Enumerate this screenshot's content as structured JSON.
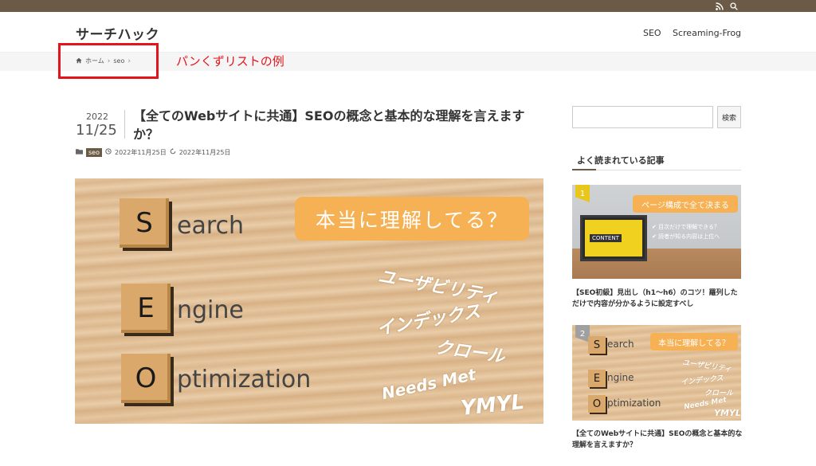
{
  "site": {
    "title": "サーチハック"
  },
  "topbar": {
    "rss_icon": "rss-icon",
    "search_icon": "search-icon"
  },
  "nav": {
    "items": [
      "SEO",
      "Screaming-Frog"
    ]
  },
  "breadcrumb": {
    "home": "ホーム",
    "sep": "›",
    "current": "seo"
  },
  "annotation": {
    "label": "パンくずリストの例",
    "color": "#e5141b"
  },
  "post": {
    "year": "2022",
    "day": "11/25",
    "title": "【全てのWebサイトに共通】SEOの概念と基本的な理解を言えますか？",
    "category": "seo",
    "published": "2022年11月25日",
    "updated": "2022年11月25日"
  },
  "hero": {
    "tiles": [
      "S",
      "E",
      "O"
    ],
    "words": [
      "earch",
      "ngine",
      "ptimization"
    ],
    "pill": "本当に理解してる？",
    "handwriting": [
      "ユーザビリティ",
      "インデックス",
      "クロール",
      "Needs Met",
      "YMYL"
    ]
  },
  "sidebar": {
    "search_placeholder": "",
    "search_button": "検索",
    "widget_title": "よく読まれている記事",
    "popular": [
      {
        "rank": "1",
        "thumb_pill": "ページ構成で全て決まる",
        "thumb_content": "CONTENT",
        "thumb_lines": [
          "✔ 目次だけで理解できる？",
          "✔ 読者が知る内容は上位へ"
        ],
        "title": "【SEO初級】見出し（h1〜h6）のコツ！羅列しただけで内容が分かるように設定すべし"
      },
      {
        "rank": "2",
        "thumb_pill": "本当に理解してる？",
        "title": "【全てのWebサイトに共通】SEOの概念と基本的な理解を言えますか？"
      }
    ]
  },
  "colors": {
    "brand": "#6b5a45",
    "accent": "#f6b154"
  }
}
